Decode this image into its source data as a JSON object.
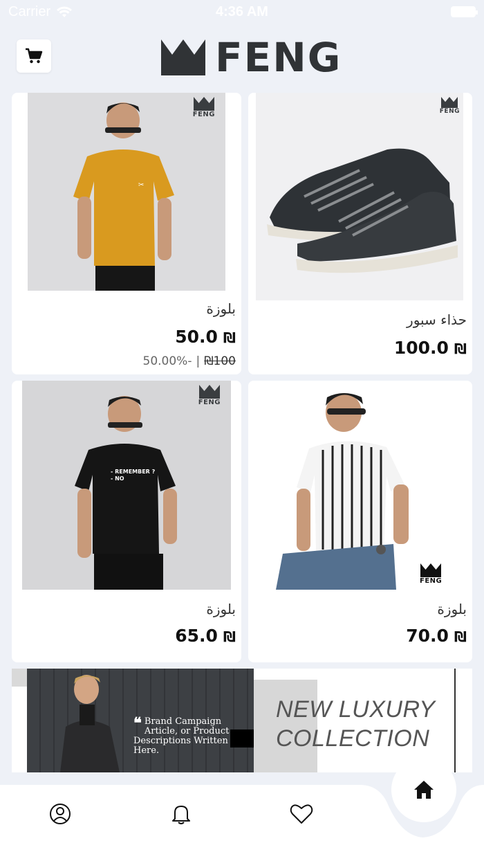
{
  "status_bar": {
    "carrier": "Carrier",
    "time": "4:36 AM"
  },
  "header": {
    "logo_text": "FENG",
    "cart_icon": "cart-icon"
  },
  "products": [
    {
      "name": "بلوزة",
      "price": "50.0",
      "currency": "₪",
      "old_price": "₪100",
      "discount": "50.00%-",
      "separator": "|",
      "brand_mark": "FENG"
    },
    {
      "name": "حذاء سبور",
      "price": "100.0",
      "currency": "₪",
      "brand_mark": "FENG"
    },
    {
      "name": "بلوزة",
      "price": "65.0",
      "currency": "₪",
      "brand_mark": "FENG",
      "shirt_text": "- REMEMBER ?\n- NO"
    },
    {
      "name": "بلوزة",
      "price": "70.0",
      "currency": "₪",
      "brand_mark": "FENG"
    }
  ],
  "banner": {
    "quote_mark": "❝",
    "quote_text": "Brand Campaign Article, or Product Descriptions Written Here.",
    "headline_line1": "NEW LUXURY",
    "headline_line2": "COLLECTION"
  },
  "nav": {
    "items": [
      "profile-icon",
      "bell-icon",
      "heart-icon",
      "home-icon"
    ]
  },
  "colors": {
    "background": "#eef1f7",
    "card": "#ffffff",
    "text": "#111111",
    "logo": "#303336"
  }
}
